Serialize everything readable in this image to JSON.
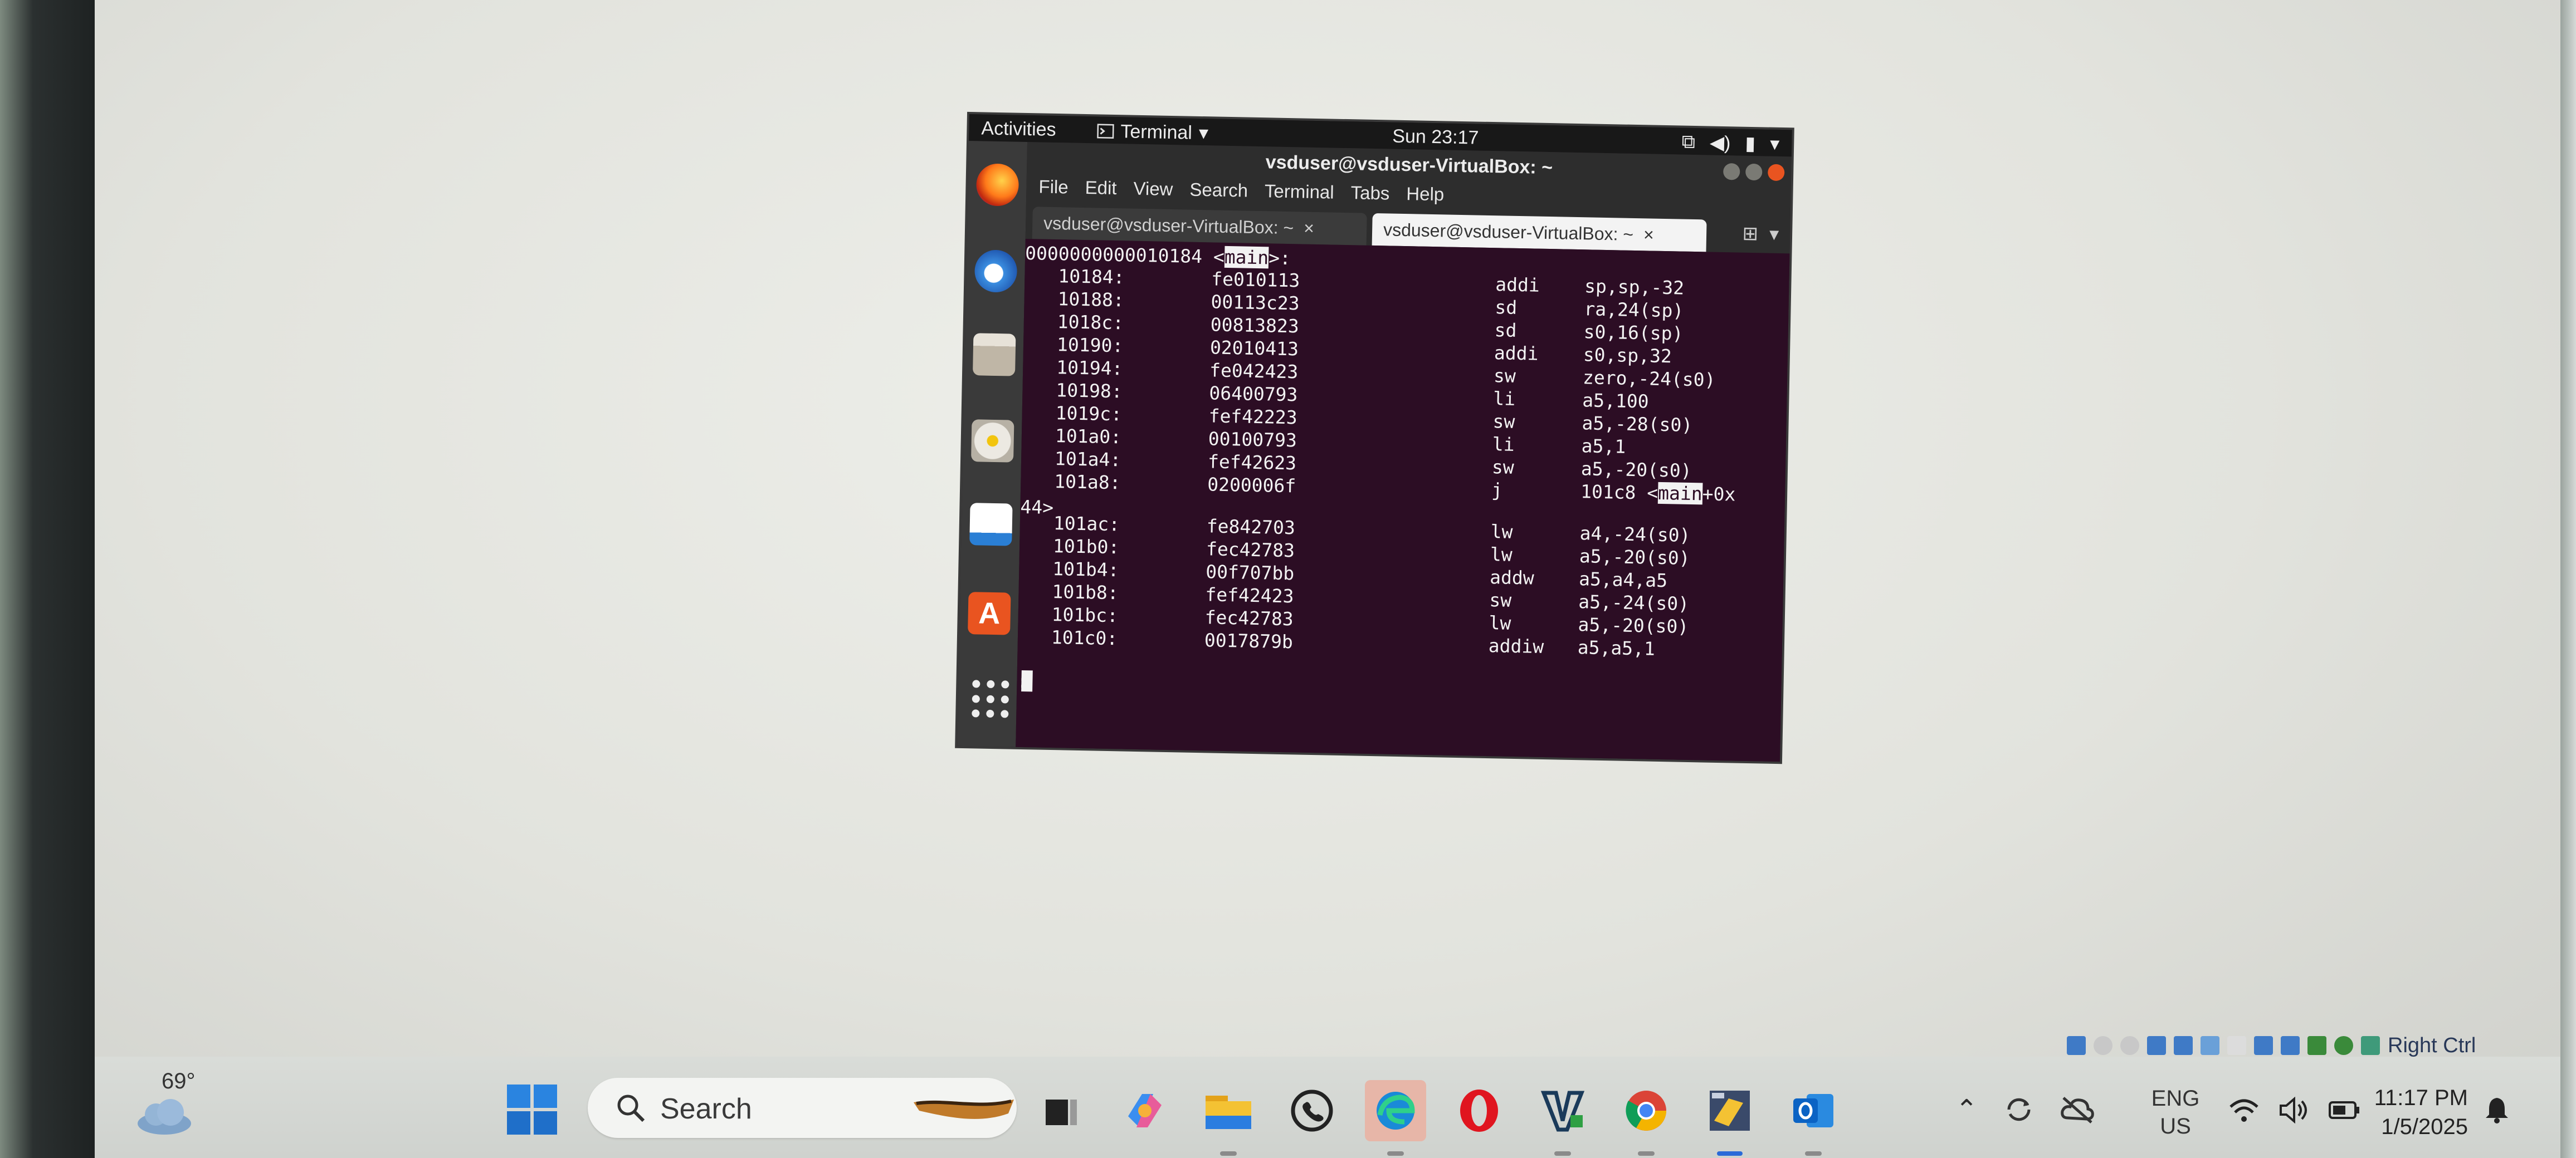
{
  "topbar": {
    "activities": "Activities",
    "app_menu": "Terminal",
    "clock": "Sun 23:17"
  },
  "terminal": {
    "window_title": "vsduser@vsduser-VirtualBox: ~",
    "menu": [
      "File",
      "Edit",
      "View",
      "Search",
      "Terminal",
      "Tabs",
      "Help"
    ],
    "tabs": [
      "vsduser@vsduser-VirtualBox: ~",
      "vsduser@vsduser-VirtualBox: ~"
    ],
    "tab_close": "×",
    "header": {
      "address": "0000000000010184",
      "open": " <",
      "symbol": "main",
      "close": ">:"
    },
    "rows": [
      {
        "addr": "10184:",
        "hex": "fe010113",
        "mnemonic": "addi",
        "operands": "sp,sp,-32"
      },
      {
        "addr": "10188:",
        "hex": "00113c23",
        "mnemonic": "sd",
        "operands": "ra,24(sp)"
      },
      {
        "addr": "1018c:",
        "hex": "00813823",
        "mnemonic": "sd",
        "operands": "s0,16(sp)"
      },
      {
        "addr": "10190:",
        "hex": "02010413",
        "mnemonic": "addi",
        "operands": "s0,sp,32"
      },
      {
        "addr": "10194:",
        "hex": "fe042423",
        "mnemonic": "sw",
        "operands": "zero,-24(s0)"
      },
      {
        "addr": "10198:",
        "hex": "06400793",
        "mnemonic": "li",
        "operands": "a5,100"
      },
      {
        "addr": "1019c:",
        "hex": "fef42223",
        "mnemonic": "sw",
        "operands": "a5,-28(s0)"
      },
      {
        "addr": "101a0:",
        "hex": "00100793",
        "mnemonic": "li",
        "operands": "a5,1"
      },
      {
        "addr": "101a4:",
        "hex": "fef42623",
        "mnemonic": "sw",
        "operands": "a5,-20(s0)"
      },
      {
        "addr": "101a8:",
        "hex": "0200006f",
        "mnemonic": "j",
        "operands": "101c8 <"
      },
      {
        "addr": "101ac:",
        "hex": "fe842703",
        "mnemonic": "lw",
        "operands": "a4,-24(s0)"
      },
      {
        "addr": "101b0:",
        "hex": "fec42783",
        "mnemonic": "lw",
        "operands": "a5,-20(s0)"
      },
      {
        "addr": "101b4:",
        "hex": "00f707bb",
        "mnemonic": "addw",
        "operands": "a5,a4,a5"
      },
      {
        "addr": "101b8:",
        "hex": "fef42423",
        "mnemonic": "sw",
        "operands": "a5,-24(s0)"
      },
      {
        "addr": "101bc:",
        "hex": "fec42783",
        "mnemonic": "lw",
        "operands": "a5,-20(s0)"
      },
      {
        "addr": "101c0:",
        "hex": "0017879b",
        "mnemonic": "addiw",
        "operands": "a5,a5,1"
      }
    ],
    "jump_symbol": "main",
    "jump_suffix": "+0x",
    "wrap_line": "44>",
    "prompt": ":"
  },
  "host_tray_strip": {
    "label": "Right Ctrl"
  },
  "taskbar": {
    "weather_temp": "69°",
    "search_label": "Search",
    "lang_line1": "ENG",
    "lang_line2": "US",
    "time": "11:17 PM",
    "date": "1/5/2025"
  },
  "colors": {
    "terminal_bg": "#2c0d24",
    "ubuntu_orange": "#e95420",
    "taskbar_bg": "#d4d7d3"
  },
  "icons": [
    "firefox-icon",
    "thunderbird-icon",
    "files-icon",
    "rhythmbox-icon",
    "writer-icon",
    "software-icon",
    "app-grid-icon",
    "windows-start-icon",
    "search-icon",
    "copilot-icon",
    "file-explorer-icon",
    "whatsapp-icon",
    "edge-icon",
    "opera-icon",
    "visual-studio-icon",
    "chrome-icon",
    "virtualbox-icon",
    "outlook-icon",
    "chevron-up-icon",
    "sync-icon",
    "cloud-off-icon",
    "wifi-icon",
    "volume-icon",
    "battery-icon",
    "bell-icon"
  ]
}
